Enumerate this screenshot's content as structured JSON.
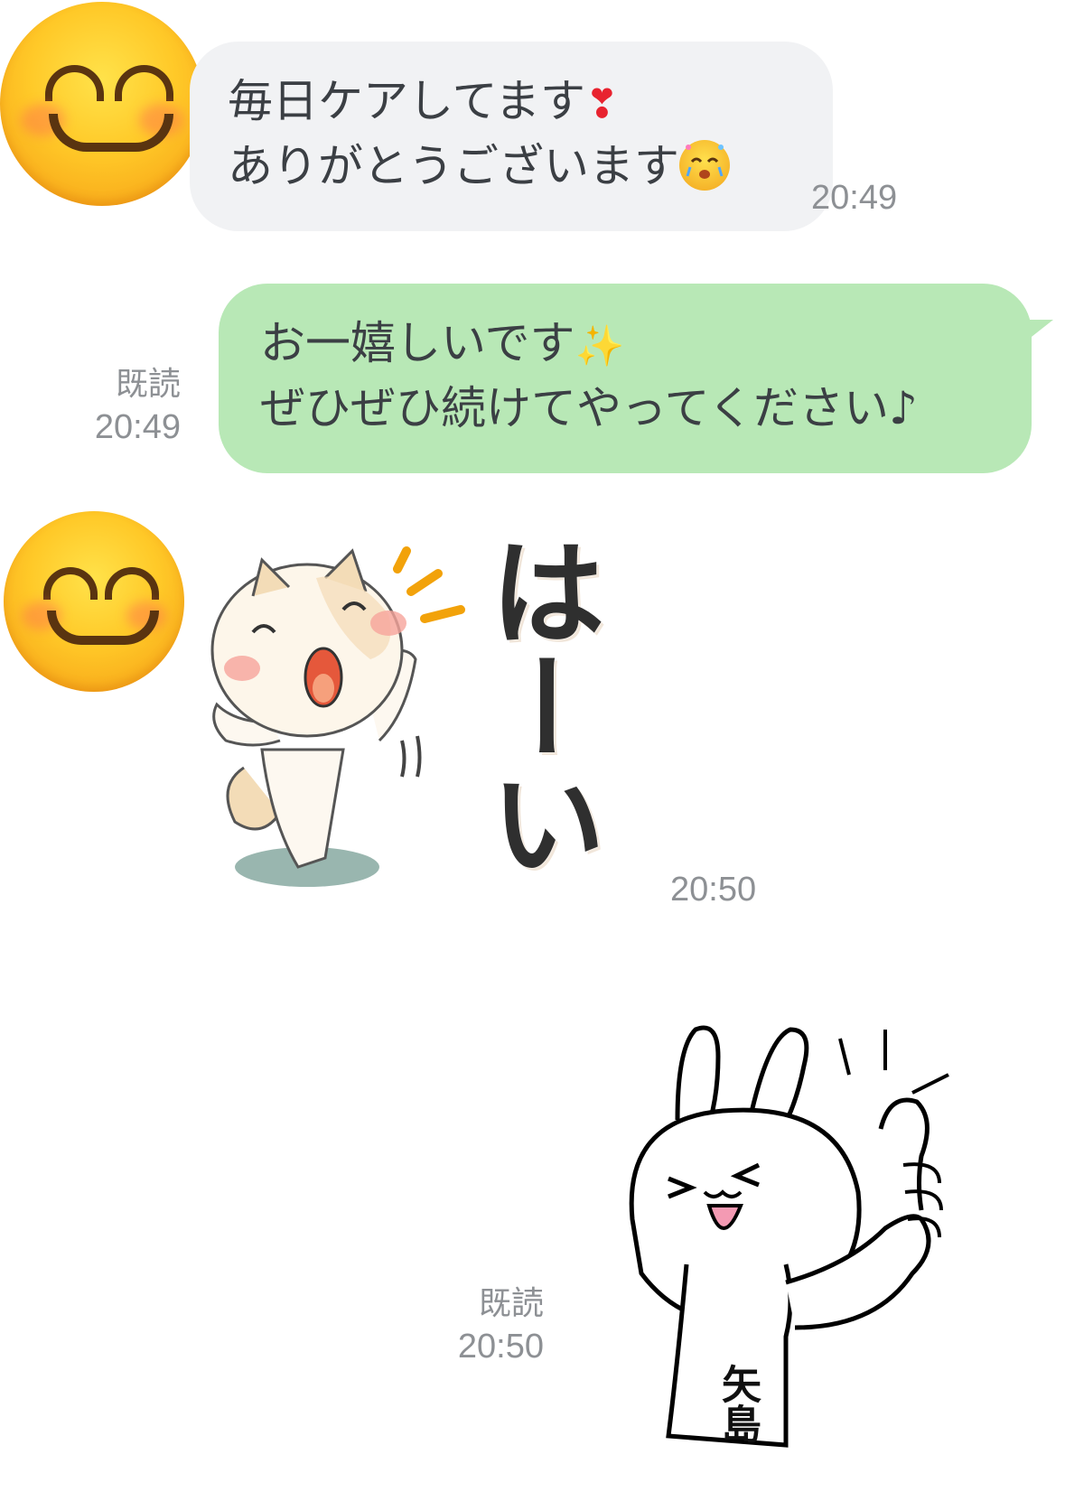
{
  "messages": {
    "incoming_1": {
      "line1": "毎日ケアしてます",
      "line1_emoji": "❣",
      "line2": "ありがとうございます",
      "line2_emoji": "grateful-face-emoji",
      "time": "20:49"
    },
    "outgoing_1": {
      "line1": "お一嬉しいです",
      "line1_emoji": "✨",
      "line2": "ぜひぜひ続けてやってください♪",
      "read": "既読",
      "time": "20:49"
    },
    "incoming_sticker": {
      "sticker_text": "はーい",
      "time": "20:50"
    },
    "outgoing_sticker": {
      "name_tag": "矢島",
      "read": "既読",
      "time": "20:50"
    }
  },
  "colors": {
    "incoming_bubble": "#f1f2f4",
    "outgoing_bubble": "#b8e8b6",
    "meta_text": "#8d9094"
  },
  "icons": {
    "avatar": "smiling-face-icon",
    "heart": "heart-exclamation-icon",
    "sparkles": "sparkles-icon"
  }
}
